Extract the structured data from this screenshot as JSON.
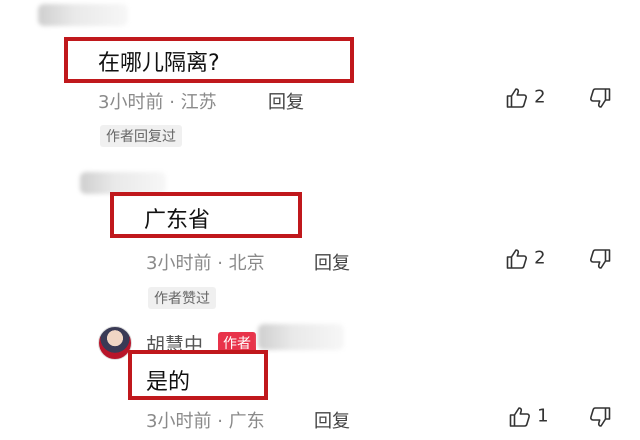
{
  "comments": [
    {
      "text": "在哪儿隔离?",
      "time": "3小时前",
      "location": "江苏",
      "reply_label": "回复",
      "likes": "2",
      "tag": "作者回复过"
    },
    {
      "text": "广东省",
      "time": "3小时前",
      "location": "北京",
      "reply_label": "回复",
      "likes": "2",
      "tag": "作者赞过"
    },
    {
      "username": "胡慧中",
      "badge": "作者",
      "text": "是的",
      "time": "3小时前",
      "location": "广东",
      "reply_label": "回复",
      "likes": "1"
    }
  ],
  "separator": "·",
  "icons": {
    "like": "thumb-up-icon",
    "dislike": "thumb-down-icon"
  },
  "colors": {
    "highlight": "#c0181c",
    "author_badge": "#e8334a"
  }
}
